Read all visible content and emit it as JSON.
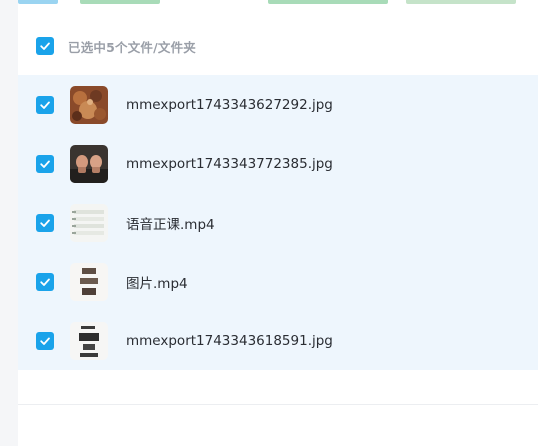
{
  "selection": {
    "header_label": "已选中5个文件/文件夹"
  },
  "files": [
    {
      "name": "mmexport1743343627292.jpg",
      "icon": "photo-thumbnail-icon",
      "checked": true
    },
    {
      "name": "mmexport1743343772385.jpg",
      "icon": "photo-thumbnail-icon",
      "checked": true
    },
    {
      "name": "语音正课.mp4",
      "icon": "video-thumbnail-icon",
      "checked": true
    },
    {
      "name": "图片.mp4",
      "icon": "video-thumbnail-icon",
      "checked": true
    },
    {
      "name": "mmexport1743343618591.jpg",
      "icon": "photo-thumbnail-icon",
      "checked": true
    }
  ],
  "colors": {
    "accent": "#1aa3ea",
    "selected_bg": "#eef6fd",
    "header_text": "#9a9fa8"
  }
}
